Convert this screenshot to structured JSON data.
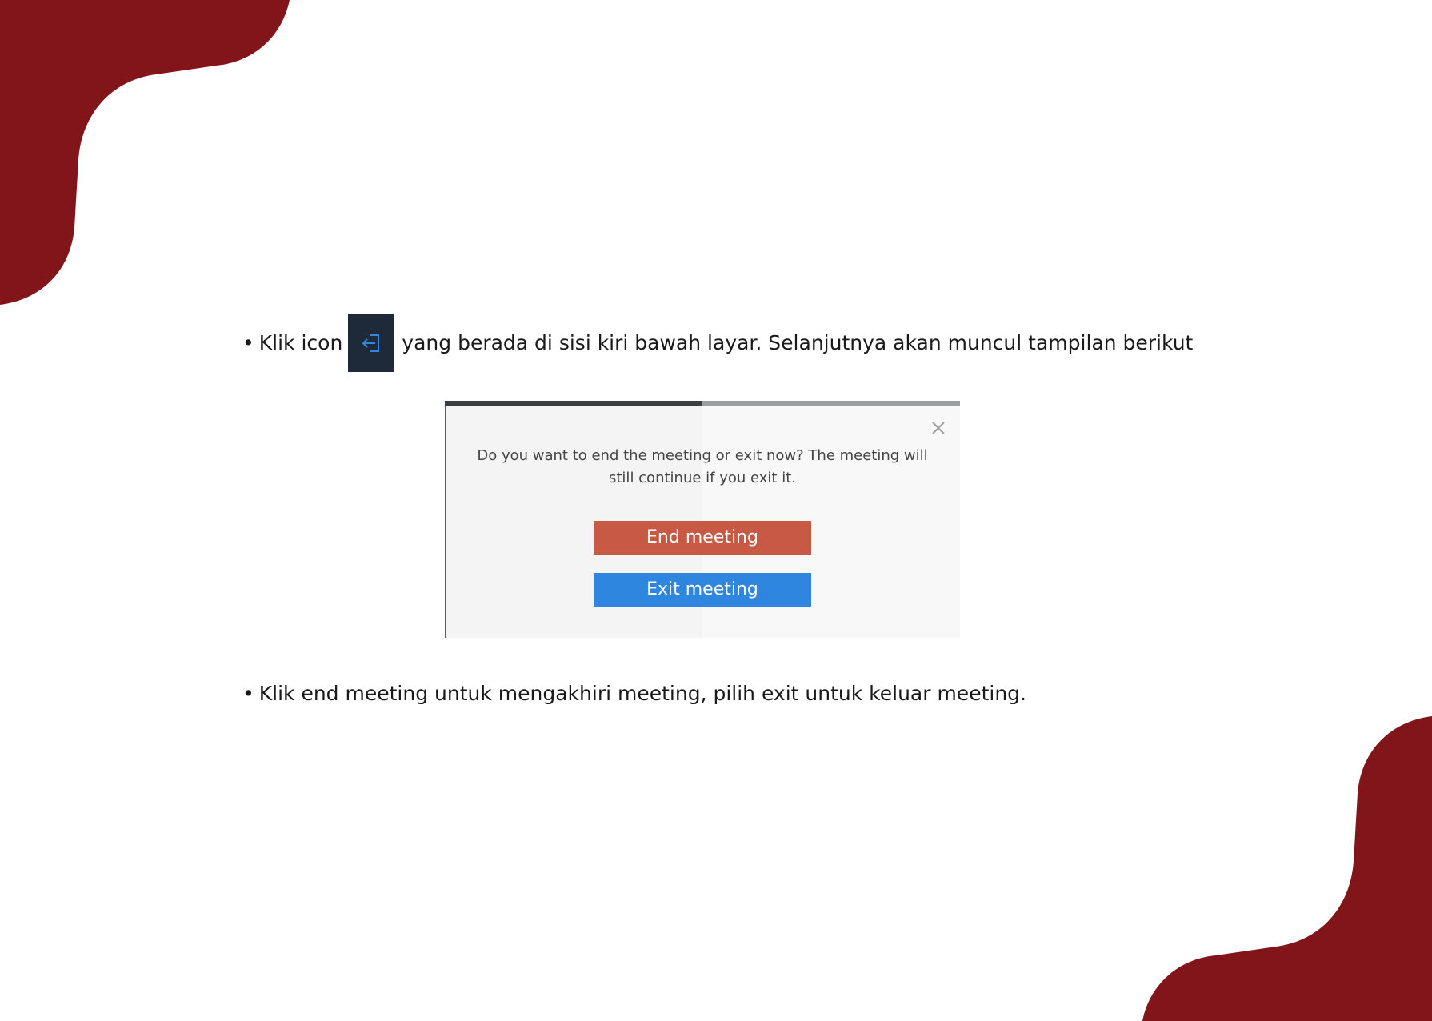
{
  "colors": {
    "accent_maroon": "#81151a",
    "icon_tile_bg": "#1e2a3a",
    "icon_blue": "#2e86de",
    "end_button_bg": "#c85a45",
    "exit_button_bg": "#2e86de"
  },
  "bullets": [
    {
      "marker": "•",
      "text_before_icon": "Klik icon",
      "icon": "exit-door-arrow-icon",
      "text_after_icon": "yang berada di sisi kiri bawah layar. Selanjutnya akan muncul tampilan berikut"
    },
    {
      "marker": "•",
      "text": "Klik end meeting untuk mengakhiri meeting, pilih exit untuk keluar meeting."
    }
  ],
  "dialog": {
    "message_line_1": "Do you want to end the meeting or exit now? The meeting will",
    "message_line_2": "still continue if you exit it.",
    "close_icon": "close-icon",
    "end_button_label": "End meeting",
    "exit_button_label": "Exit meeting"
  }
}
